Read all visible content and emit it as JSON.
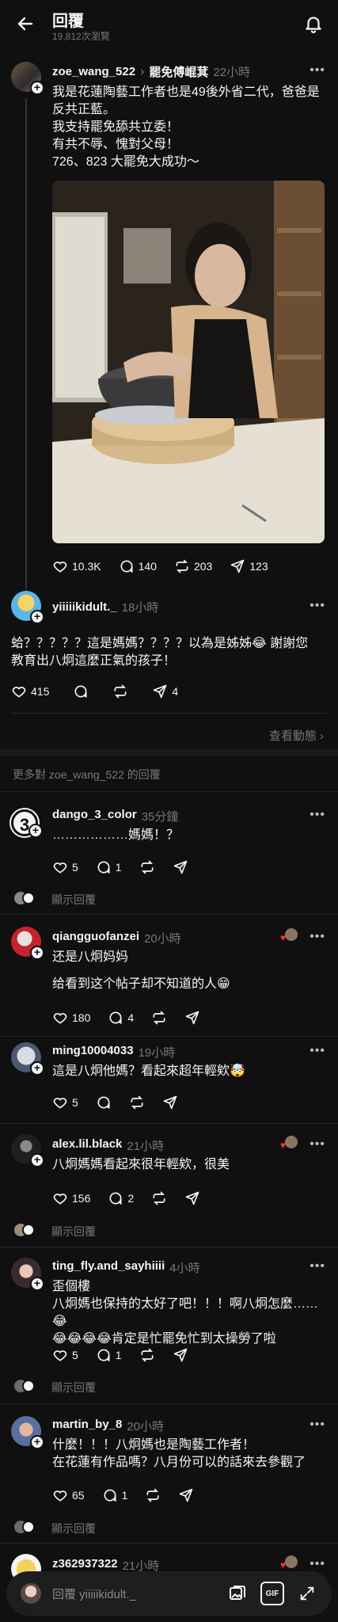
{
  "header": {
    "title": "回覆",
    "views": "19,812次瀏覽"
  },
  "main_post": {
    "username": "zoe_wang_522",
    "reply_to": "罷免傅崐萁",
    "time": "22小時",
    "lines": [
      "我是花蓮陶藝工作者也是49後外省二代，爸爸是",
      "反共正藍。",
      "我支持罷免舔共立委！",
      "有共不辱、愧對父母！",
      "726、823 大罷免大成功～"
    ],
    "likes": "10.3K",
    "comments": "140",
    "reposts": "203",
    "shares": "123"
  },
  "reply_post": {
    "username": "yiiiiikidult._",
    "time": "18小時",
    "lines": [
      "蛤？？？？？這是媽媽？？？？以為是姊姊😂 謝謝您",
      "教育出八炯這麼正氣的孩子！"
    ],
    "likes": "415",
    "shares": "4",
    "view_activity": "查看動態"
  },
  "more_replies_label": "更多對 zoe_wang_522 的回覆",
  "show_replies": "顯示回覆",
  "comments": [
    {
      "username": "dango_3_color",
      "time": "35分鐘",
      "lines": [
        "………………媽媽！？"
      ],
      "likes": "5",
      "comments": "1",
      "shares": ""
    },
    {
      "username": "qiangguofanzei",
      "time": "20小時",
      "lines": [
        "还是八炯妈妈",
        "给看到这个帖子却不知道的人😁"
      ],
      "likes": "180",
      "comments": "4",
      "shares": ""
    },
    {
      "username": "ming10004033",
      "time": "19小時",
      "lines": [
        "這是八炯他媽？看起來超年輕欸🤯"
      ],
      "likes": "5",
      "comments": "",
      "shares": ""
    },
    {
      "username": "alex.lil.black",
      "time": "21小時",
      "lines": [
        "八炯媽媽看起來很年輕欸，很美"
      ],
      "likes": "156",
      "comments": "2",
      "shares": ""
    },
    {
      "username": "ting_fly.and_sayhiiii",
      "time": "4小時",
      "lines": [
        "歪個樓",
        "八炯媽也保持的太好了吧！！！啊八炯怎麼……😂",
        "😂😂😂😂肯定是忙罷免忙到太操勞了啦"
      ],
      "likes": "5",
      "comments": "1",
      "shares": ""
    },
    {
      "username": "martin_by_8",
      "time": "20小時",
      "lines": [
        "什麼！！！八炯媽也是陶藝工作者！",
        "在花蓮有作品嗎？八月份可以的話來去參觀了"
      ],
      "likes": "65",
      "comments": "1",
      "shares": ""
    },
    {
      "username": "z362937322",
      "time": "21小時",
      "lines": [],
      "likes": "",
      "comments": "",
      "shares": ""
    }
  ],
  "composer": {
    "placeholder": "回覆 yiiiiikidult._",
    "gif": "GIF"
  },
  "colors": {
    "bg": "#101010",
    "text": "#f3f5f7",
    "muted": "#777777",
    "heart": "#ff3040"
  }
}
